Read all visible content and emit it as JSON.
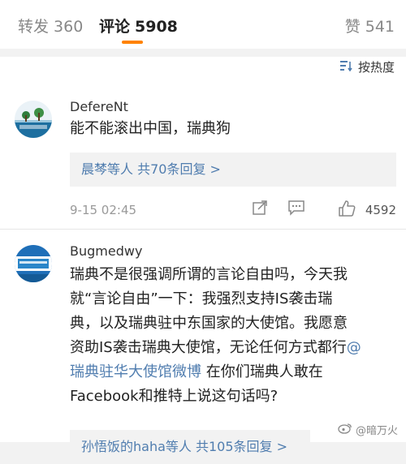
{
  "tabs": {
    "repost": {
      "label": "转发",
      "count": "360"
    },
    "comment": {
      "label": "评论",
      "count": "5908"
    },
    "like": {
      "label": "赞",
      "count": "541"
    }
  },
  "sort": {
    "label": "按热度",
    "icon": "sort-list-icon"
  },
  "comments": [
    {
      "username": "DefereNt",
      "text": "能不能滚出中国，瑞典狗",
      "reply_summary": "晨棽等人 共70条回复 >",
      "time": "9-15 02:45",
      "likes": "4592"
    },
    {
      "username": "Bugmedwy",
      "text_lines": [
        "瑞典不是很强调所谓的言论自由吗，今天我",
        "就“言论自由”一下：我强烈支持IS袭击瑞",
        "典，以及瑞典驻中东国家的大使馆。我愿意",
        "资助IS袭击瑞典大使馆，无论任何方式都行",
        "瑞典驻华大使馆微博",
        " 在你们瑞典人敢在",
        "Facebook和推特上说这句话吗?"
      ],
      "mention": "@",
      "reply_summary": "孙悟饭的haha等人 共105条回复 >"
    }
  ],
  "watermark": "@暗万火",
  "colors": {
    "accent": "#ff8200",
    "link": "#507daf"
  }
}
